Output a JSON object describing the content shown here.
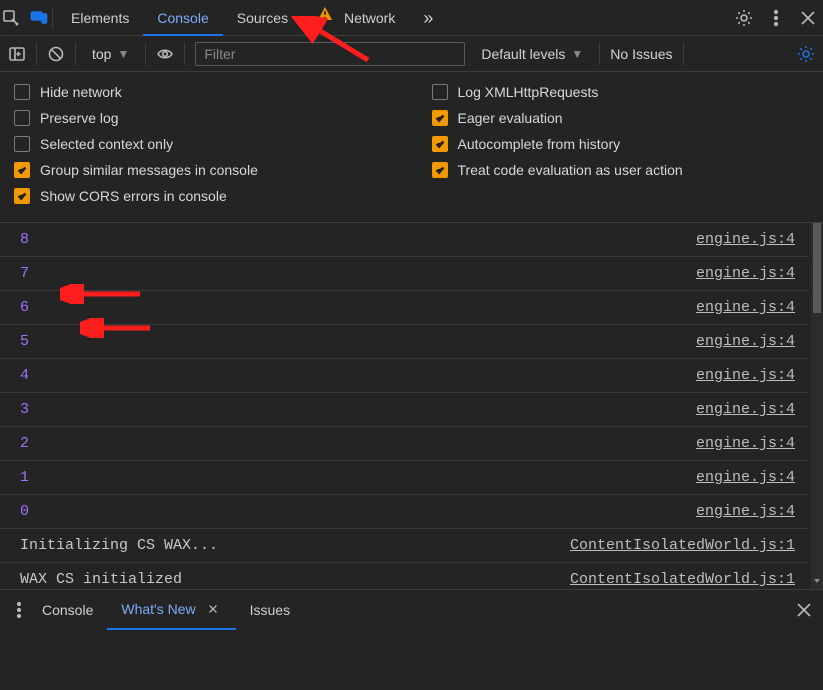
{
  "tabs": {
    "elements": "Elements",
    "console": "Console",
    "sources": "Sources",
    "network": "Network",
    "more": "»"
  },
  "toolbar": {
    "context": "top",
    "filter_placeholder": "Filter",
    "levels": "Default levels",
    "issues": "No Issues"
  },
  "settings": {
    "hide_network": "Hide network",
    "preserve_log": "Preserve log",
    "selected_context": "Selected context only",
    "group_similar": "Group similar messages in console",
    "show_cors": "Show CORS errors in console",
    "log_xhr": "Log XMLHttpRequests",
    "eager_eval": "Eager evaluation",
    "autocomplete": "Autocomplete from history",
    "treat_eval": "Treat code evaluation as user action"
  },
  "logs": [
    {
      "msg": "8",
      "type": "num",
      "src": "engine.js:4"
    },
    {
      "msg": "7",
      "type": "num",
      "src": "engine.js:4"
    },
    {
      "msg": "6",
      "type": "num",
      "src": "engine.js:4"
    },
    {
      "msg": "5",
      "type": "num",
      "src": "engine.js:4"
    },
    {
      "msg": "4",
      "type": "num",
      "src": "engine.js:4"
    },
    {
      "msg": "3",
      "type": "num",
      "src": "engine.js:4"
    },
    {
      "msg": "2",
      "type": "num",
      "src": "engine.js:4"
    },
    {
      "msg": "1",
      "type": "num",
      "src": "engine.js:4"
    },
    {
      "msg": "0",
      "type": "num",
      "src": "engine.js:4"
    },
    {
      "msg": "Initializing CS WAX...",
      "type": "str",
      "src": "ContentIsolatedWorld.js:1"
    },
    {
      "msg": "WAX CS initialized",
      "type": "str",
      "src": "ContentIsolatedWorld.js:1"
    }
  ],
  "drawer": {
    "console": "Console",
    "whatsnew": "What's New",
    "issues": "Issues"
  }
}
